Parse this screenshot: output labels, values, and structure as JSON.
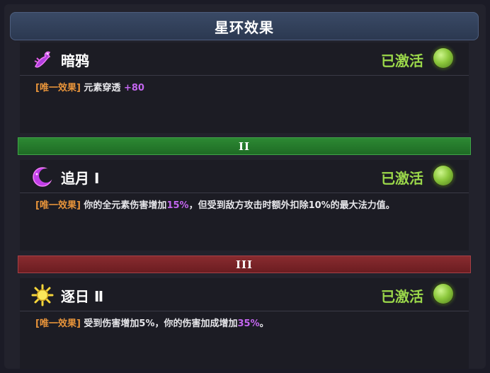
{
  "title": "星环效果",
  "sections": [
    {
      "name": "暗鸦",
      "icon": "crow-icon",
      "status": "已激活",
      "tag": "[唯一效果]",
      "desc_pre": "元素穿透 ",
      "desc_highlight": "+80",
      "desc_mid": "",
      "desc_highlight2": "",
      "desc_post": ""
    },
    {
      "name": "追月 Ⅰ",
      "icon": "crescent-moon-icon",
      "status": "已激活",
      "tag": "[唯一效果]",
      "desc_pre": "你的全元素伤害增加",
      "desc_highlight": "15%",
      "desc_mid": "，但受到敌方攻击时额外扣除10%的最大法力值。",
      "desc_highlight2": "",
      "desc_post": ""
    },
    {
      "name": "逐日 Ⅱ",
      "icon": "sun-icon",
      "status": "已激活",
      "tag": "[唯一效果]",
      "desc_pre": "受到伤害增加5%，你的伤害加成增加",
      "desc_highlight": "35%",
      "desc_mid": "。",
      "desc_highlight2": "",
      "desc_post": ""
    }
  ],
  "dividers": [
    "II",
    "III"
  ],
  "colors": {
    "status_green": "#9bd84a",
    "tag_orange": "#e8943a",
    "highlight_purple": "#c466f0",
    "divider_green": "#2d8a34",
    "divider_red": "#8a2c30"
  }
}
